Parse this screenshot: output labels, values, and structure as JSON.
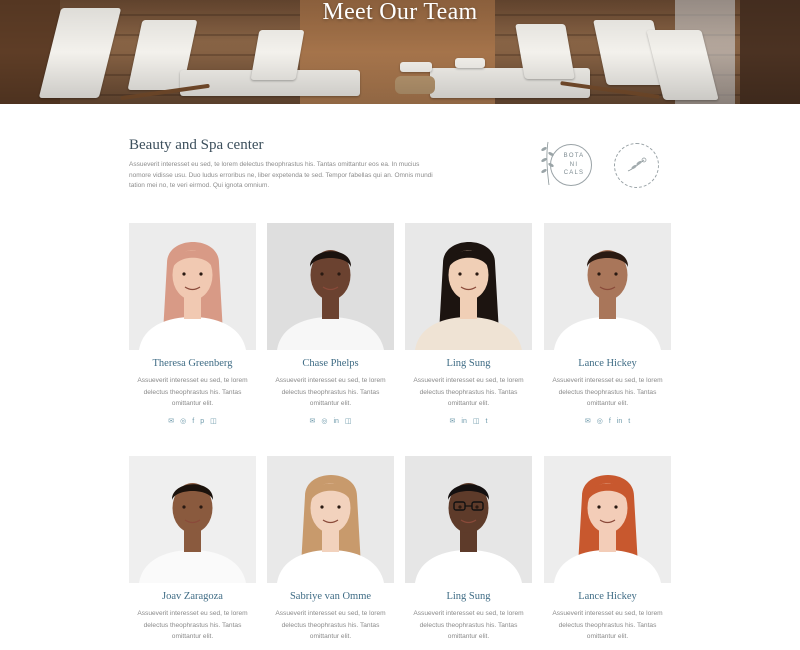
{
  "hero": {
    "title": "Meet Our Team"
  },
  "intro": {
    "title": "Beauty and Spa center",
    "text": "Assueverit interesset eu sed, te lorem delectus theophrastus his. Tantas omittantur eos ea. In mucius nomore vidisse usu. Duo ludus erroribus ne, liber expetenda te sed. Tempor fabellas qui an. Omnis mundi tation mei no, te veri eirmod. Qui ignota omnium."
  },
  "badges": {
    "botanicals": [
      "BOTA",
      "NI",
      "CALS"
    ],
    "herbal_icon": "herbal-house-organic-products-badge"
  },
  "team": [
    {
      "name": "Theresa Greenberg",
      "desc": [
        "Assueverit interesset eu sed, te lorem",
        "delectus theophrastus his. Tantas",
        "omittantur elit."
      ],
      "socials": [
        "✉",
        "◎",
        "f",
        "p",
        "◫"
      ],
      "photo": {
        "bg": "#ececec",
        "hair": "#d89a86",
        "skin": "#f1c9b2",
        "shirt": "#ffffff",
        "icon": "portrait-woman-pink-hair"
      }
    },
    {
      "name": "Chase Phelps",
      "desc": [
        "Assueverit interesset eu sed, te lorem",
        "delectus theophrastus his. Tantas",
        "omittantur elit."
      ],
      "socials": [
        "✉",
        "◎",
        "in",
        "◫"
      ],
      "photo": {
        "bg": "#dedede",
        "hair": "#1a120e",
        "skin": "#6b4230",
        "shirt": "#f7f7f7",
        "icon": "portrait-man"
      }
    },
    {
      "name": "Ling Sung",
      "desc": [
        "Assueverit interesset eu sed, te lorem",
        "delectus theophrastus his. Tantas",
        "omittantur elit."
      ],
      "socials": [
        "✉",
        "in",
        "◫",
        "t"
      ],
      "photo": {
        "bg": "#e8e8e8",
        "hair": "#1c1410",
        "skin": "#f0cfb6",
        "shirt": "#efe3d4",
        "icon": "portrait-woman"
      }
    },
    {
      "name": "Lance Hickey",
      "desc": [
        "Assueverit interesset eu sed, te lorem",
        "delectus theophrastus his. Tantas",
        "omittantur elit."
      ],
      "socials": [
        "✉",
        "◎",
        "f",
        "in",
        "t"
      ],
      "photo": {
        "bg": "#ebebeb",
        "hair": "#2a1a12",
        "skin": "#a9765a",
        "shirt": "#ffffff",
        "icon": "portrait-man"
      }
    },
    {
      "name": "Joav Zaragoza",
      "desc": [
        "Assueverit interesset eu sed, te lorem",
        "delectus theophrastus his. Tantas",
        "omittantur elit."
      ],
      "socials": [],
      "photo": {
        "bg": "#efefef",
        "hair": "#1b120c",
        "skin": "#8a5a3e",
        "shirt": "#fafafa",
        "icon": "portrait-man-curly-hair"
      }
    },
    {
      "name": "Sabriye van Omme",
      "desc": [
        "Assueverit interesset eu sed, te lorem",
        "delectus theophrastus his. Tantas",
        "omittantur elit."
      ],
      "socials": [],
      "photo": {
        "bg": "#e9e9e9",
        "hair": "#c89a6c",
        "skin": "#f2d2bd",
        "shirt": "#ffffff",
        "icon": "portrait-woman-blonde"
      }
    },
    {
      "name": "Ling Sung",
      "desc": [
        "Assueverit interesset eu sed, te lorem",
        "delectus theophrastus his. Tantas",
        "omittantur elit."
      ],
      "socials": [],
      "photo": {
        "bg": "#e6e6e6",
        "hair": "#141010",
        "skin": "#5e3b2a",
        "shirt": "#ffffff",
        "icon": "portrait-man-glasses"
      }
    },
    {
      "name": "Lance Hickey",
      "desc": [
        "Assueverit interesset eu sed, te lorem",
        "delectus theophrastus his. Tantas",
        "omittantur elit."
      ],
      "socials": [],
      "photo": {
        "bg": "#ededed",
        "hair": "#c8582e",
        "skin": "#f3cdb8",
        "shirt": "#ffffff",
        "icon": "portrait-woman-red-hair"
      }
    }
  ],
  "colors": {
    "name": "#3f6c85",
    "heading": "#3c4f5c",
    "body": "#8a8a8a",
    "social": "#6f9aab"
  }
}
